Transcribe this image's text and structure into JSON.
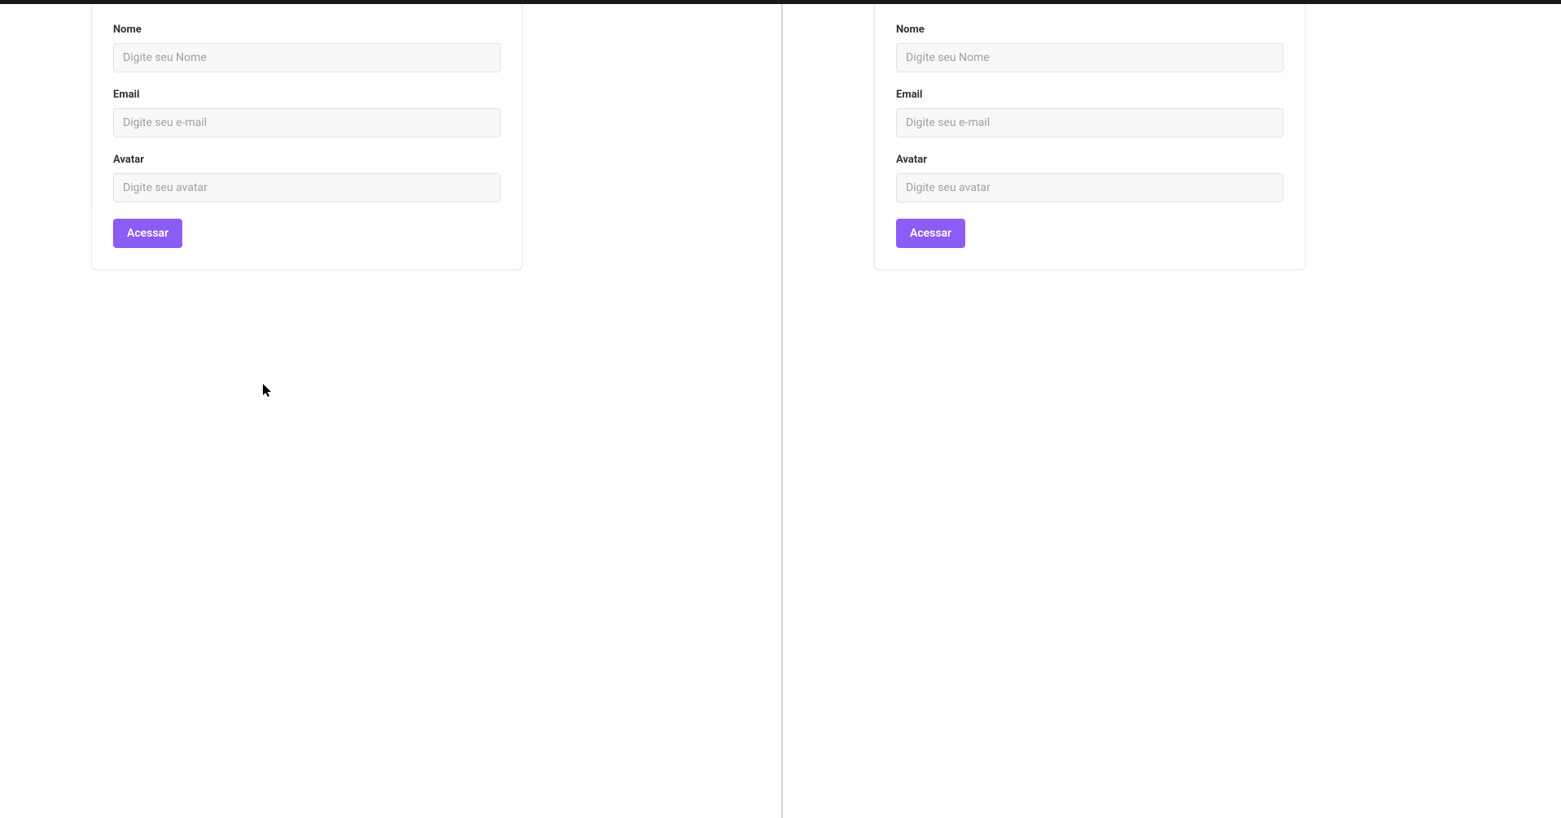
{
  "form": {
    "fields": {
      "nome": {
        "label": "Nome",
        "placeholder": "Digite seu Nome",
        "value": ""
      },
      "email": {
        "label": "Email",
        "placeholder": "Digite seu e-mail",
        "value": ""
      },
      "avatar": {
        "label": "Avatar",
        "placeholder": "Digite seu avatar",
        "value": ""
      }
    },
    "submit_label": "Acessar"
  }
}
